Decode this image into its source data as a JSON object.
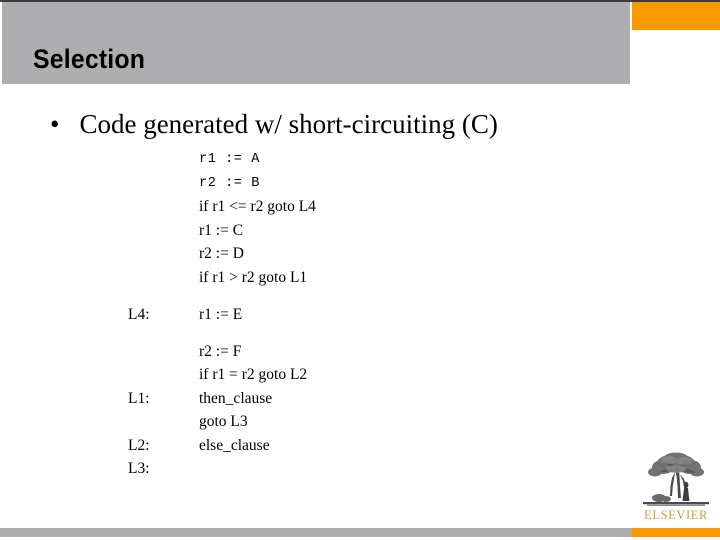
{
  "slide": {
    "title": "Selection",
    "bullet_marker": "•",
    "bullet_text": "Code generated w/ short-circuiting (C)"
  },
  "colors": {
    "header_gray": "#aeaeb0",
    "accent_orange": "#fb9900",
    "top_rule": "#3b3b3d",
    "logo_gold": "#c8a24a",
    "text": "#000000",
    "background": "#ffffff"
  },
  "code_listing": {
    "lines": [
      {
        "label": "",
        "text": "r1 := A",
        "font": "mono",
        "gap_after": false
      },
      {
        "label": "",
        "text": "r2 := B",
        "font": "mono",
        "gap_after": false
      },
      {
        "label": "",
        "text": "if r1 <= r2 goto L4",
        "font": "serif",
        "gap_after": false
      },
      {
        "label": "",
        "text": "r1 := C",
        "font": "serif",
        "gap_after": false
      },
      {
        "label": "",
        "text": "r2 := D",
        "font": "serif",
        "gap_after": false
      },
      {
        "label": "",
        "text": "if r1 > r2 goto L1",
        "font": "serif",
        "gap_after": true
      },
      {
        "label": "L4:",
        "text": "r1 := E",
        "font": "serif",
        "gap_after": true
      },
      {
        "label": "",
        "text": "r2 := F",
        "font": "serif",
        "gap_after": false
      },
      {
        "label": "",
        "text": "if r1 = r2 goto L2",
        "font": "serif",
        "gap_after": false
      },
      {
        "label": "L1:",
        "text": "then_clause",
        "font": "serif",
        "gap_after": false
      },
      {
        "label": "",
        "text": "goto L3",
        "font": "serif",
        "gap_after": false
      },
      {
        "label": "L2:",
        "text": "else_clause",
        "font": "serif",
        "gap_after": false
      },
      {
        "label": "L3:",
        "text": "",
        "font": "serif",
        "gap_after": false
      }
    ]
  },
  "logo": {
    "wordmark": "ELSEVIER",
    "emblem": "elsevier-tree-icon"
  }
}
